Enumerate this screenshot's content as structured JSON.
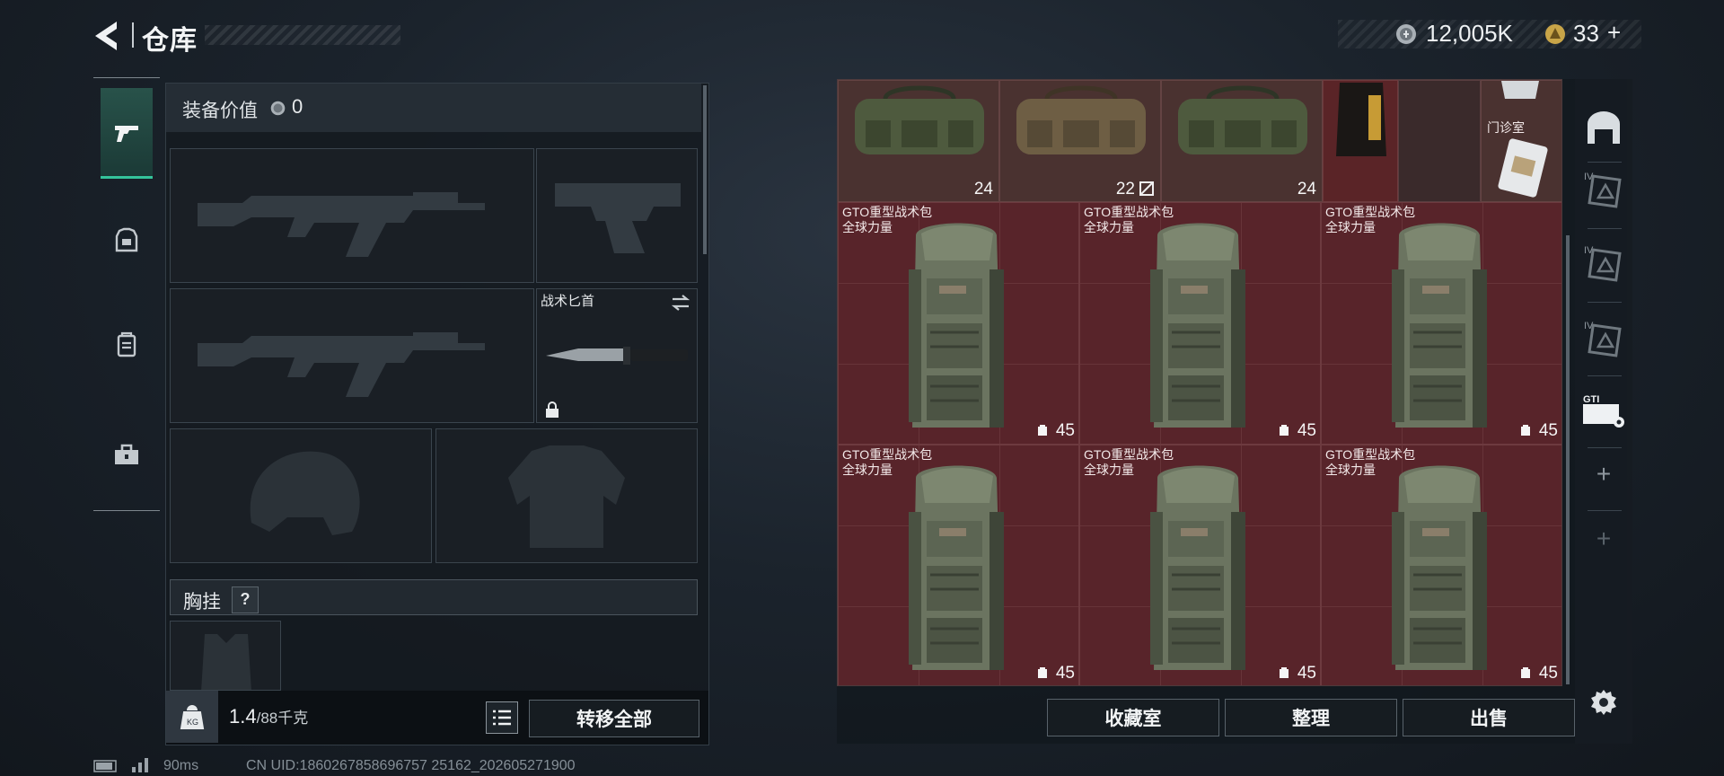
{
  "header": {
    "title": "仓库"
  },
  "currency": {
    "silver_amount": "12,005K",
    "gold_amount": "33",
    "plus": "+"
  },
  "loadout": {
    "value_label": "装备价值",
    "value_amount": "0",
    "knife_label": "战术匕首",
    "chest_label": "胸挂",
    "chest_help": "?",
    "weight_value": "1.4",
    "weight_capacity": "/88千克",
    "transfer_all": "转移全部"
  },
  "storage": {
    "duffels": [
      {
        "count": "24",
        "tint": "#4e5a3e"
      },
      {
        "count": "22",
        "tint": "#6e5e44"
      },
      {
        "count": "24",
        "tint": "#4e5a3e"
      }
    ],
    "clinic_label": "门诊室",
    "backpacks": [
      {
        "name": "GTO重型战术包",
        "brand": "全球力量",
        "count": "45"
      },
      {
        "name": "GTO重型战术包",
        "brand": "全球力量",
        "count": "45"
      },
      {
        "name": "GTO重型战术包",
        "brand": "全球力量",
        "count": "45"
      },
      {
        "name": "GTO重型战术包",
        "brand": "全球力量",
        "count": "45"
      },
      {
        "name": "GTO重型战术包",
        "brand": "全球力量",
        "count": "45"
      },
      {
        "name": "GTO重型战术包",
        "brand": "全球力量",
        "count": "45"
      }
    ]
  },
  "sidebar": {
    "level": "IV",
    "brand_text": "GTI",
    "add": "+"
  },
  "actions": {
    "collection": "收藏室",
    "sort": "整理",
    "sell": "出售"
  },
  "status": {
    "ping": "90ms",
    "uid": "CN UID:1860267858696757 25162_202605271900"
  },
  "colors": {
    "accent": "#34c39a",
    "grid_red": "#5a2427"
  },
  "icons": [
    "back-arrow-icon",
    "silver-coin-icon",
    "gold-coin-icon",
    "pistol-icon",
    "armor-icon",
    "backpack-icon",
    "toolbox-icon",
    "lock-icon",
    "swap-icon",
    "weight-icon",
    "list-icon",
    "gear-icon"
  ]
}
